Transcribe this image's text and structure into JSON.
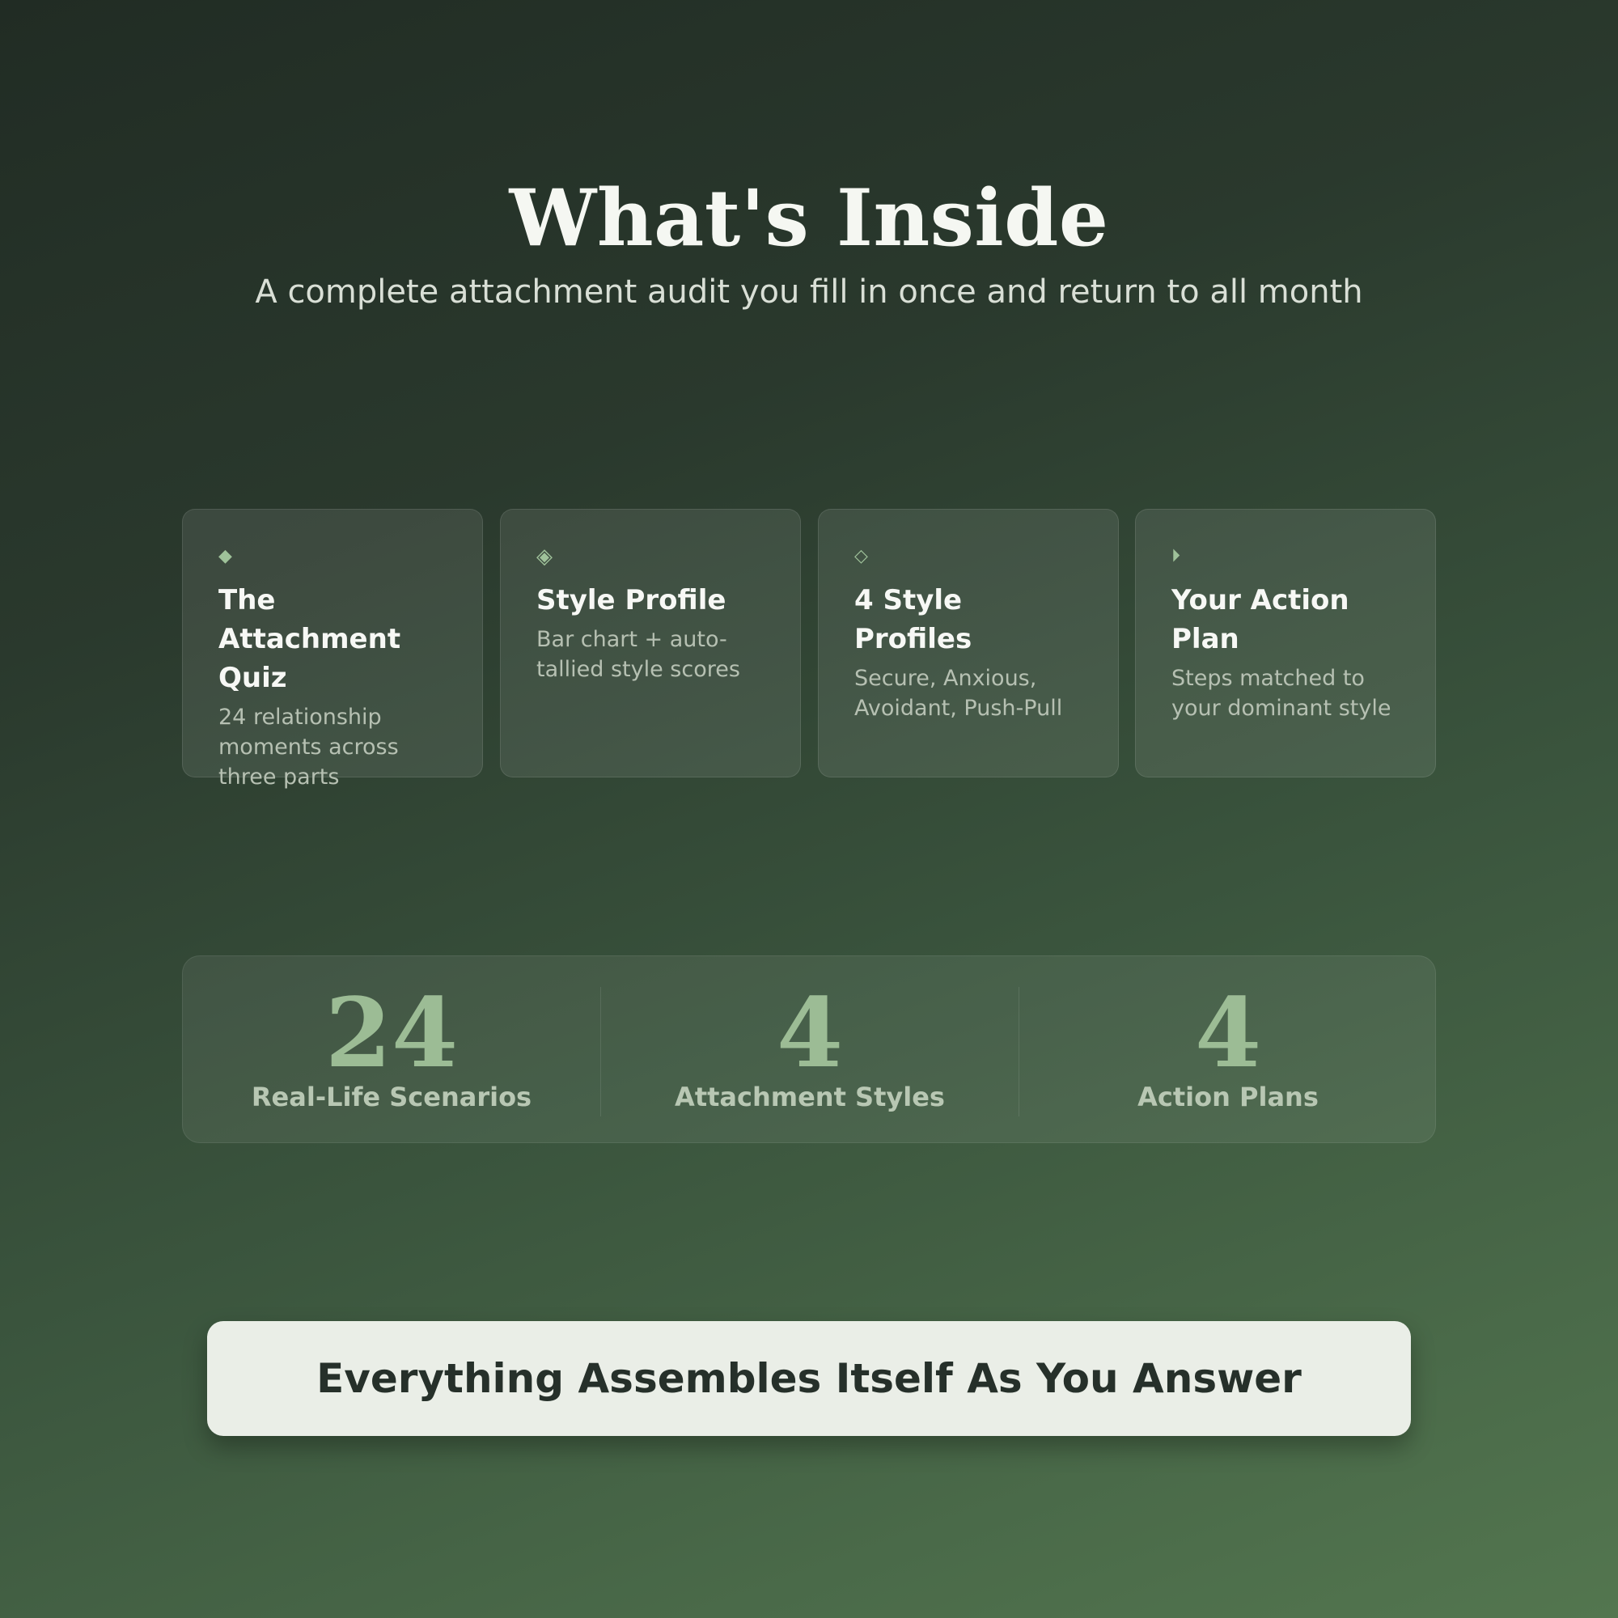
{
  "header": {
    "title": "What's Inside",
    "subtitle": "A complete attachment audit you fill in once and return to all month"
  },
  "cards": [
    {
      "icon": "◆",
      "icon_name": "diamond-icon",
      "title": "The Attachment Quiz",
      "description": "24 relationship moments across three parts"
    },
    {
      "icon": "◈",
      "icon_name": "diamond-dot-icon",
      "title": "Style Profile",
      "description": "Bar chart + auto-tallied style scores"
    },
    {
      "icon": "◇",
      "icon_name": "diamond-outline-icon",
      "title": "4 Style Profiles",
      "description": "Secure, Anxious, Avoidant, Push-Pull"
    },
    {
      "icon": "⏵",
      "icon_name": "play-icon",
      "title": "Your Action Plan",
      "description": "Steps matched to your dominant style"
    }
  ],
  "stats": [
    {
      "value": "24",
      "label": "Real-Life Scenarios"
    },
    {
      "value": "4",
      "label": "Attachment Styles"
    },
    {
      "value": "4",
      "label": "Action Plans"
    }
  ],
  "cta": {
    "label": "Everything Assembles Itself As You Answer"
  },
  "colors": {
    "accent": "#9cbc95",
    "background_top": "#212c24",
    "background_bottom": "#53764f",
    "cta_background": "#eaeee7",
    "cta_text": "#26302a"
  }
}
